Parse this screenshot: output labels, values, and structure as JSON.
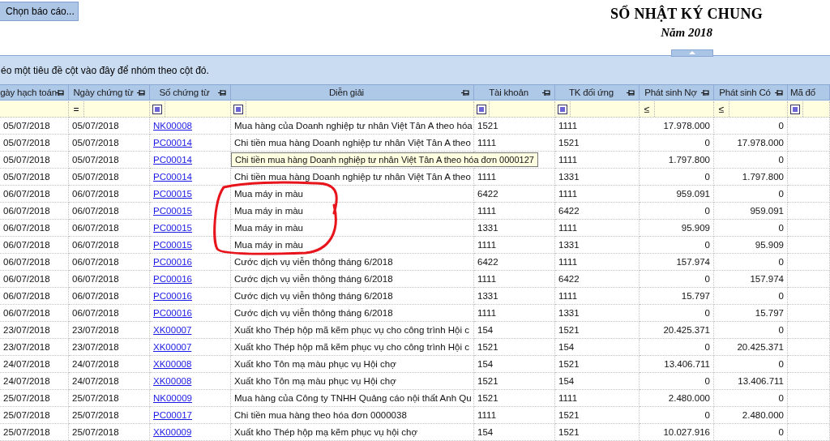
{
  "report_button": "Chọn báo cáo...",
  "title": "SỔ NHẬT KÝ CHUNG",
  "subtitle": "Năm 2018",
  "group_panel_hint": "éo một tiêu đề cột vào đây để nhóm theo cột đó.",
  "columns": [
    {
      "label": "gày hạch toán",
      "kind": "text",
      "pinned": true,
      "filter": {
        "kind": "none"
      }
    },
    {
      "label": "Ngày chứng từ",
      "kind": "text",
      "pinned": true,
      "filter": {
        "kind": "symbol",
        "symbol": "="
      }
    },
    {
      "label": "Số chứng từ",
      "kind": "link",
      "pinned": true,
      "filter": {
        "kind": "icon"
      }
    },
    {
      "label": "Diễn giải",
      "kind": "text",
      "pinned": true,
      "filter": {
        "kind": "icon"
      }
    },
    {
      "label": "Tài khoản",
      "kind": "text",
      "pinned": true,
      "filter": {
        "kind": "icon"
      }
    },
    {
      "label": "TK đối ứng",
      "kind": "text",
      "pinned": true,
      "filter": {
        "kind": "icon"
      }
    },
    {
      "label": "Phát sinh Nợ",
      "kind": "amount",
      "pinned": true,
      "filter": {
        "kind": "symbol",
        "symbol": "≤"
      }
    },
    {
      "label": "Phát sinh Có",
      "kind": "amount",
      "pinned": true,
      "filter": {
        "kind": "symbol",
        "symbol": "≤"
      }
    },
    {
      "label": "Mã đố",
      "kind": "text",
      "pinned": false,
      "filter": {
        "kind": "icon"
      }
    }
  ],
  "rows": [
    {
      "cells": [
        "05/07/2018",
        "05/07/2018",
        "NK00008",
        "Mua hàng của Doanh nghiệp tư nhân Việt Tân A theo hóa",
        "1521",
        "1111",
        "17.978.000",
        "0"
      ],
      "tooltip": false
    },
    {
      "cells": [
        "05/07/2018",
        "05/07/2018",
        "PC00014",
        "Chi tiền mua hàng Doanh nghiệp tư nhân Việt Tân A theo",
        "1111",
        "1521",
        "0",
        "17.978.000"
      ],
      "tooltip": false
    },
    {
      "cells": [
        "05/07/2018",
        "05/07/2018",
        "PC00014",
        "Chi tiền mua hàng Doanh nghiệp tư nhân Việt Tân A theo hóa đơn 0000127",
        "",
        "1111",
        "1.797.800",
        "0"
      ],
      "tooltip": true
    },
    {
      "cells": [
        "05/07/2018",
        "05/07/2018",
        "PC00014",
        "Chi tiền mua hàng Doanh nghiệp tư nhân Việt Tân A theo",
        "1111",
        "1331",
        "0",
        "1.797.800"
      ],
      "tooltip": false
    },
    {
      "cells": [
        "06/07/2018",
        "06/07/2018",
        "PC00015",
        "Mua máy in màu",
        "6422",
        "1111",
        "959.091",
        "0"
      ],
      "tooltip": false
    },
    {
      "cells": [
        "06/07/2018",
        "06/07/2018",
        "PC00015",
        "Mua máy in màu",
        "1111",
        "6422",
        "0",
        "959.091"
      ],
      "tooltip": false
    },
    {
      "cells": [
        "06/07/2018",
        "06/07/2018",
        "PC00015",
        "Mua máy in màu",
        "1331",
        "1111",
        "95.909",
        "0"
      ],
      "tooltip": false
    },
    {
      "cells": [
        "06/07/2018",
        "06/07/2018",
        "PC00015",
        "Mua máy in màu",
        "1111",
        "1331",
        "0",
        "95.909"
      ],
      "tooltip": false
    },
    {
      "cells": [
        "06/07/2018",
        "06/07/2018",
        "PC00016",
        "Cước dịch vụ viễn thông tháng 6/2018",
        "6422",
        "1111",
        "157.974",
        "0"
      ],
      "tooltip": false
    },
    {
      "cells": [
        "06/07/2018",
        "06/07/2018",
        "PC00016",
        "Cước dịch vụ viễn thông tháng 6/2018",
        "1111",
        "6422",
        "0",
        "157.974"
      ],
      "tooltip": false
    },
    {
      "cells": [
        "06/07/2018",
        "06/07/2018",
        "PC00016",
        "Cước dịch vụ viễn thông tháng 6/2018",
        "1331",
        "1111",
        "15.797",
        "0"
      ],
      "tooltip": false
    },
    {
      "cells": [
        "06/07/2018",
        "06/07/2018",
        "PC00016",
        "Cước dịch vụ viễn thông tháng 6/2018",
        "1111",
        "1331",
        "0",
        "15.797"
      ],
      "tooltip": false
    },
    {
      "cells": [
        "23/07/2018",
        "23/07/2018",
        "XK00007",
        "Xuất kho Thép hộp mã kẽm  phục vụ cho công trình Hội c",
        "154",
        "1521",
        "20.425.371",
        "0"
      ],
      "tooltip": false
    },
    {
      "cells": [
        "23/07/2018",
        "23/07/2018",
        "XK00007",
        "Xuất kho Thép hộp mã kẽm  phục vụ cho công trình Hội c",
        "1521",
        "154",
        "0",
        "20.425.371"
      ],
      "tooltip": false
    },
    {
      "cells": [
        "24/07/2018",
        "24/07/2018",
        "XK00008",
        "Xuất kho Tôn mạ màu phục vụ Hội chợ",
        "154",
        "1521",
        "13.406.711",
        "0"
      ],
      "tooltip": false
    },
    {
      "cells": [
        "24/07/2018",
        "24/07/2018",
        "XK00008",
        "Xuất kho Tôn mạ màu phục vụ Hội chợ",
        "1521",
        "154",
        "0",
        "13.406.711"
      ],
      "tooltip": false
    },
    {
      "cells": [
        "25/07/2018",
        "25/07/2018",
        "NK00009",
        "Mua hàng của Công ty TNHH Quảng cáo nội thất Anh Qu",
        "1521",
        "1111",
        "2.480.000",
        "0"
      ],
      "tooltip": false
    },
    {
      "cells": [
        "25/07/2018",
        "25/07/2018",
        "PC00017",
        "Chi tiền mua hàng theo hóa đơn 0000038",
        "1111",
        "1521",
        "0",
        "2.480.000"
      ],
      "tooltip": false
    },
    {
      "cells": [
        "25/07/2018",
        "25/07/2018",
        "XK00009",
        "Xuất kho Thép hộp mạ kẽm  phục vụ hội chợ",
        "154",
        "1521",
        "10.027.916",
        "0"
      ],
      "tooltip": false
    }
  ]
}
